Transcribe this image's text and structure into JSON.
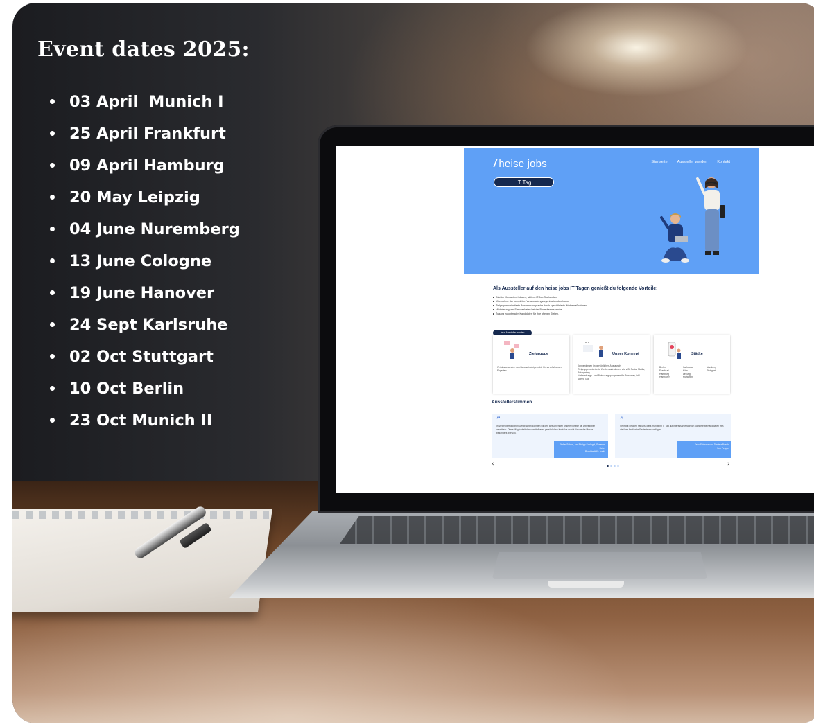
{
  "overlay": {
    "heading": "Event dates 2025:",
    "events": [
      "03 April  Munich I",
      "25 April Frankfurt",
      "09 April Hamburg",
      "20 May Leipzig",
      "04 June Nuremberg",
      "13 June Cologne",
      "19 June Hanover",
      "24 Sept Karlsruhe",
      "02 Oct Stuttgart",
      "10 Oct Berlin",
      "23 Oct Munich II"
    ]
  },
  "site": {
    "logo": {
      "mark": "/",
      "name": "heise jobs"
    },
    "badge": "IT Tag",
    "nav": [
      "Startseite",
      "Aussteller werden",
      "Kontakt"
    ],
    "heading": "Als Aussteller auf den heise jobs IT Tagen genießt du folgende Vorteile:",
    "bullets": [
      "Direkter Kontakt mit lokalen, aktiven IT-Job-Suchenden.",
      "Übernahme der kompletten Veranstaltungsorganisation durch uns.",
      "Zielgruppenorientierte Bewerberansprache durch spezialisierte Werbemaßnahmen.",
      "Minimierung von Streuverlusten bei der Bewerberansprache.",
      "Zugang zu optimalen Kandidaten für Ihre offenen Stellen."
    ],
    "cta": "Jetzt Aussteller werden",
    "cards": [
      {
        "title": "Zielgruppe",
        "text": "IT-Jobsuchende - von Berufseinsteigern bis hin zu erfahrenen Experten."
      },
      {
        "title": "Unser Konzept",
        "text": "Kennenlernen im persönlichen Austausch\nZielgruppenorientierte Werbemaßnahmen wie z.B. Social Media, Retargeting\nVorbereitungs- und Betreuungsprogramm für Bewerber, inkl. Speed Talk"
      },
      {
        "title": "Städte",
        "cities": [
          "Berlin",
          "Frankfurt",
          "Hamburg",
          "Hannover",
          "Karlsruhe",
          "Köln",
          "Leipzig",
          "München",
          "Nürnberg",
          "Stuttgart"
        ]
      }
    ],
    "testimonials_heading": "Ausstellerstimmen",
    "testimonials": [
      {
        "quote_mark": "”",
        "text": "In vielen persönlichen Gesprächen konnten wir den Besuchenden unsere Vorteile als Arbeitgeber vermitteln. Diese Möglichkeit des unmittelbaren persönlichen Kontakts macht für uns die Messe besonders wertvoll.",
        "author": "Stefan Schon, Jan Philipp Schlegel, Susanne Keller\nRundstedt für Justiz"
      },
      {
        "quote_mark": "”",
        "text": "Sehr gut gefallen hat uns, dass man beim IT Tag auf interessante fachlich kompetente Kandidaten trifft, die über fundiertes Fachwissen verfügen.",
        "author": "Felix Schwarz und Daniela Busch\nSch People"
      }
    ],
    "prev": "‹",
    "next": "›"
  }
}
